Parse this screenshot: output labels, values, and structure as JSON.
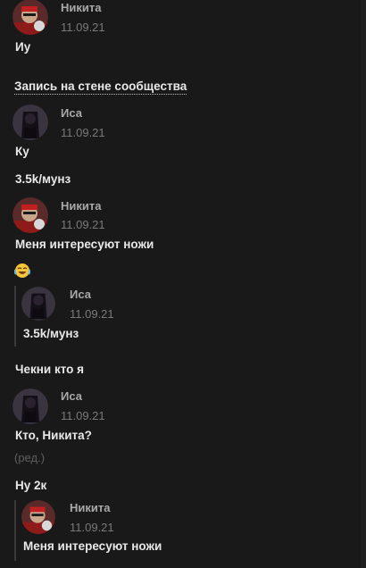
{
  "messages": {
    "m1": {
      "author": "Никита",
      "date": "11.09.21",
      "text": "Иу"
    },
    "wall_post_link": "Запись на стене сообщества",
    "m2": {
      "author": "Иса",
      "date": "11.09.21",
      "text": "Ку",
      "text2": "3.5k/мунз"
    },
    "m3": {
      "author": "Никита",
      "date": "11.09.21",
      "text": "Меня интересуют ножи",
      "emoji": "laughing-tears-emoji",
      "reply": {
        "author": "Иса",
        "date": "11.09.21",
        "text": "3.5k/мунз"
      },
      "text2": "Чекни кто я"
    },
    "m4": {
      "author": "Иса",
      "date": "11.09.21",
      "text": "Кто, Никита?",
      "edited": "(ред.)",
      "text2": "Ну 2к",
      "reply": {
        "author": "Никита",
        "date": "11.09.21",
        "text": "Меня интересуют ножи"
      }
    }
  },
  "colors": {
    "background": "#191919",
    "author_name": "#a9a9a9",
    "date": "#7a7a7a",
    "message_text": "#e8e8e8",
    "edited": "#5f5f5f"
  }
}
